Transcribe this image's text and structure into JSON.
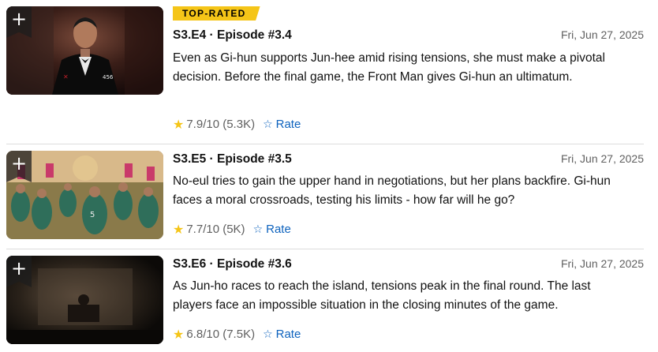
{
  "episodes": [
    {
      "badge": "TOP-RATED",
      "title": "S3.E4 · Episode #3.4",
      "date": "Fri, Jun 27, 2025",
      "description": "Even as Gi-hun supports Jun-hee amid rising tensions, she must make a pivotal decision. Before the final game, the Front Man gives Gi-hun an ultimatum.",
      "rating": "7.9/10 (5.3K)",
      "rate_label": "Rate",
      "add_label": "+"
    },
    {
      "title": "S3.E5 · Episode #3.5",
      "date": "Fri, Jun 27, 2025",
      "description": "No-eul tries to gain the upper hand in negotiations, but her plans backfire. Gi-hun faces a moral crossroads, testing his limits - how far will he go?",
      "rating": "7.7/10 (5K)",
      "rate_label": "Rate",
      "add_label": "+"
    },
    {
      "title": "S3.E6 · Episode #3.6",
      "date": "Fri, Jun 27, 2025",
      "description": "As Jun-ho races to reach the island, tensions peak in the final round. The last players face an impossible situation in the closing minutes of the game.",
      "rating": "6.8/10 (7.5K)",
      "rate_label": "Rate",
      "add_label": "+"
    }
  ],
  "thumbnail_texts": {
    "ep4_player_number": "456",
    "ep5_player_number": "5"
  },
  "colors": {
    "badge": "#f5c518",
    "star": "#f5c518",
    "link": "#0e63be"
  },
  "icons": [
    "plus-icon",
    "star-icon",
    "star-outline-icon"
  ]
}
